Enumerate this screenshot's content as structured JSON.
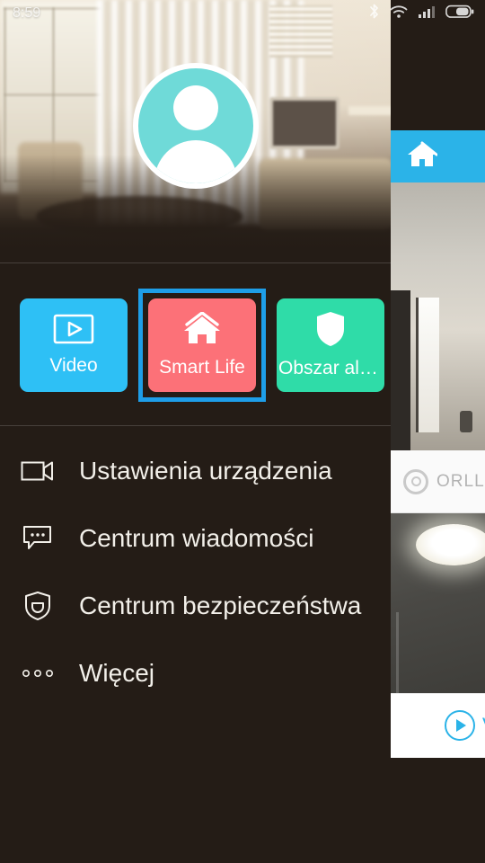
{
  "status_bar": {
    "time": "8:59",
    "icons": [
      "bluetooth-icon",
      "wifi-icon",
      "signal-icon",
      "battery-icon"
    ]
  },
  "header": {
    "avatar_alt": "user-avatar",
    "avatar_color": "#6fdad8",
    "background_alt": "living-room-photo"
  },
  "tiles": [
    {
      "id": "video",
      "label": "Video",
      "icon": "video-play-icon",
      "color": "#2EC0F5",
      "selected": false
    },
    {
      "id": "smart-life",
      "label": "Smart Life",
      "icon": "home-icon",
      "color": "#FC7178",
      "selected": true
    },
    {
      "id": "alarm-area",
      "label": "Obszar ala...",
      "icon": "shield-icon",
      "color": "#2FDCA8",
      "selected": false
    }
  ],
  "selection_color": "#1E9EE8",
  "menu": [
    {
      "id": "device-settings",
      "label": "Ustawienia urządzenia",
      "icon": "video-camera-icon"
    },
    {
      "id": "message-center",
      "label": "Centrum wiadomości",
      "icon": "message-bubble-icon"
    },
    {
      "id": "security-center",
      "label": "Centrum bezpieczeństwa",
      "icon": "shield-lock-icon"
    },
    {
      "id": "more",
      "label": "Więcej",
      "icon": "more-dots-icon"
    }
  ],
  "app_panel": {
    "topbar_color": "#2BB3E8",
    "topbar_icon": "home-icon",
    "device_name": "ORLLO",
    "device_icon": "camera-lens-icon",
    "play_label": "V",
    "play_icon": "play-circle-icon",
    "camera_1_alt": "camera-feed-hallway",
    "camera_2_alt": "camera-feed-ceiling-light"
  }
}
